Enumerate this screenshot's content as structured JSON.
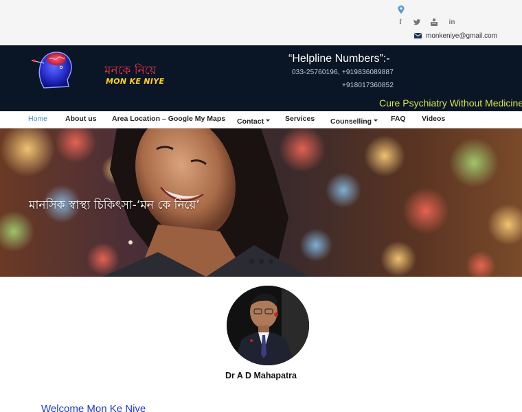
{
  "topbar": {
    "icons": [
      "map-marker-icon",
      "facebook-icon",
      "twitter-icon",
      "youtube-icon",
      "linkedin-icon",
      "envelope-icon"
    ],
    "social_glyphs": {
      "facebook": "f",
      "linkedin": "in"
    },
    "email": "monkeniye@gmail.com"
  },
  "header": {
    "logo_bengali": "মনকে নিয়ে",
    "logo_english": "MON KE NIYE",
    "helpline_title": "“Helpline Numbers”:-",
    "helpline_numbers_line1": "033-25760196, +919836089887",
    "helpline_numbers_line2": "+918017360852",
    "tagline": "Cure Psychiatry Without Medicine",
    "colors": {
      "background": "#0a1526",
      "tagline": "#d5e84b",
      "logo_bengali": "#ff3344",
      "logo_english": "#ffd21f"
    }
  },
  "nav": {
    "items": [
      {
        "label": "Home",
        "active": true
      },
      {
        "label": "About us",
        "active": false
      },
      {
        "label": "Area Location – Google My Maps",
        "active": false
      },
      {
        "label": "Contact",
        "active": false,
        "dropdown": true
      },
      {
        "label": "Services",
        "active": false
      },
      {
        "label": "Counselling",
        "active": false,
        "dropdown": true
      },
      {
        "label": "FAQ",
        "active": false
      },
      {
        "label": "Videos",
        "active": false
      }
    ],
    "active_color": "#3a86c7"
  },
  "hero": {
    "caption": "মানসিক স্বাস্থ্য চিকিৎসা-‘মন কে নিয়ে’",
    "slide_count": 3
  },
  "profile": {
    "name": "Dr A D Mahapatra"
  },
  "welcome": {
    "heading": "Welcome Mon Ke Niye",
    "color": "#1a37d6"
  }
}
